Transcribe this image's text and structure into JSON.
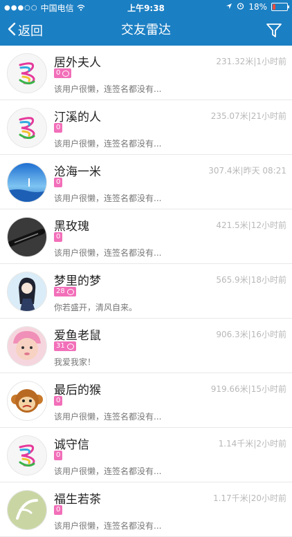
{
  "status_bar": {
    "carrier": "中国电信",
    "time": "上午9:38",
    "battery": "18%",
    "battery_fraction": 0.18
  },
  "nav": {
    "back_label": "返回",
    "title": "交友雷达"
  },
  "rows": [
    {
      "name": "居外夫人",
      "meta": "231.32米|1小时前",
      "badge": "0",
      "badge_icon": true,
      "signature": "该用户很懒，连签名都没有...",
      "avatar": "swirl"
    },
    {
      "name": "汀溪的人",
      "meta": "235.07米|21小时前",
      "badge": "0",
      "badge_icon": false,
      "signature": "该用户很懒，连签名都没有...",
      "avatar": "swirl"
    },
    {
      "name": "沧海一米",
      "meta": "307.4米|昨天 08:21",
      "badge": "0",
      "badge_icon": false,
      "signature": "该用户很懒，连签名都没有...",
      "avatar": "sea"
    },
    {
      "name": "黑玫瑰",
      "meta": "421.5米|12小时前",
      "badge": "0",
      "badge_icon": false,
      "signature": "该用户很懒，连签名都没有...",
      "avatar": "dark"
    },
    {
      "name": "梦里的梦",
      "meta": "565.9米|18小时前",
      "badge": "28",
      "badge_icon": true,
      "signature": "你若盛开，清风自来。",
      "avatar": "anime"
    },
    {
      "name": "爱鱼老鼠",
      "meta": "906.3米|16小时前",
      "badge": "31",
      "badge_icon": true,
      "signature": "我爱我家！",
      "avatar": "baby"
    },
    {
      "name": "最后的猴",
      "meta": "919.66米|15小时前",
      "badge": "0",
      "badge_icon": false,
      "signature": "该用户很懒，连签名都没有...",
      "avatar": "monkey"
    },
    {
      "name": "诚守信",
      "meta": "1.14千米|2小时前",
      "badge": "0",
      "badge_icon": false,
      "signature": "该用户很懒，连签名都没有...",
      "avatar": "swirl"
    },
    {
      "name": "福生若茶",
      "meta": "1.17千米|20小时前",
      "badge": "0",
      "badge_icon": false,
      "signature": "该用户很懒，连签名都没有...",
      "avatar": "tea"
    }
  ],
  "colors": {
    "primary": "#1b7fc3",
    "badge": "#f26fb9"
  }
}
